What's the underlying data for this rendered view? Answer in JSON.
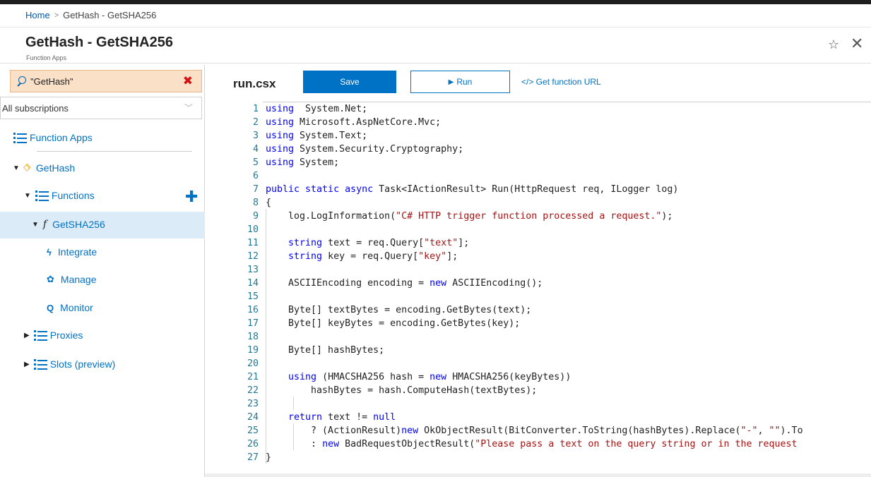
{
  "breadcrumb": {
    "home": "Home",
    "separator": ">",
    "current": "GetHash - GetSHA256"
  },
  "header": {
    "title": "GetHash - GetSHA256",
    "subtitle": "Function Apps",
    "pin_icon": "☆",
    "close_icon": "✕"
  },
  "sidebar": {
    "search_value": "\"GetHash\"",
    "clear_icon": "✖",
    "subscriptions": "All subscriptions",
    "chevron": "﹀",
    "function_apps": "Function Apps",
    "app_name": "GetHash",
    "functions_label": "Functions",
    "add_icon": "✚",
    "function_name": "GetSHA256",
    "function_glyph": "f",
    "integrate": "Integrate",
    "manage": "Manage",
    "monitor": "Monitor",
    "proxies": "Proxies",
    "slots": "Slots (preview)",
    "expand_tri": "▼",
    "collapse_tri": "▶",
    "integrate_icon": "ϟ",
    "manage_icon": "✿",
    "monitor_icon": "Q"
  },
  "toolbar": {
    "file": "run.csx",
    "save": "Save",
    "run": "Run",
    "run_icon": "▶",
    "get_url": "</> Get function URL"
  },
  "accent_color": "#0072c6",
  "editor": {
    "lines": [
      {
        "n": "1",
        "parts": [
          [
            "kw",
            "using"
          ],
          [
            "",
            "  System.Net;"
          ]
        ]
      },
      {
        "n": "2",
        "parts": [
          [
            "kw",
            "using"
          ],
          [
            "",
            " Microsoft.AspNetCore.Mvc;"
          ]
        ]
      },
      {
        "n": "3",
        "parts": [
          [
            "kw",
            "using"
          ],
          [
            "",
            " System.Text;"
          ]
        ]
      },
      {
        "n": "4",
        "parts": [
          [
            "kw",
            "using"
          ],
          [
            "",
            " System.Security.Cryptography;"
          ]
        ]
      },
      {
        "n": "5",
        "parts": [
          [
            "kw",
            "using"
          ],
          [
            "",
            " System;"
          ]
        ]
      },
      {
        "n": "6",
        "parts": []
      },
      {
        "n": "7",
        "parts": [
          [
            "kw",
            "public static async"
          ],
          [
            "",
            " Task<IActionResult> Run(HttpRequest req, ILogger log)"
          ]
        ]
      },
      {
        "n": "8",
        "parts": [
          [
            "",
            "{"
          ]
        ]
      },
      {
        "n": "9",
        "parts": [
          [
            "",
            "    log.LogInformation("
          ],
          [
            "str",
            "\"C# HTTP trigger function processed a request.\""
          ],
          [
            "",
            ");"
          ]
        ]
      },
      {
        "n": "10",
        "parts": []
      },
      {
        "n": "11",
        "parts": [
          [
            "kw",
            "    string"
          ],
          [
            "",
            " text = req.Query["
          ],
          [
            "str",
            "\"text\""
          ],
          [
            "",
            "];"
          ]
        ]
      },
      {
        "n": "12",
        "parts": [
          [
            "kw",
            "    string"
          ],
          [
            "",
            " key = req.Query["
          ],
          [
            "str",
            "\"key\""
          ],
          [
            "",
            "];"
          ]
        ]
      },
      {
        "n": "13",
        "parts": []
      },
      {
        "n": "14",
        "parts": [
          [
            "",
            "    ASCIIEncoding encoding = "
          ],
          [
            "kw",
            "new"
          ],
          [
            "",
            " ASCIIEncoding();"
          ]
        ]
      },
      {
        "n": "15",
        "parts": []
      },
      {
        "n": "16",
        "parts": [
          [
            "",
            "    Byte[] textBytes = encoding.GetBytes(text);"
          ]
        ]
      },
      {
        "n": "17",
        "parts": [
          [
            "",
            "    Byte[] keyBytes = encoding.GetBytes(key);"
          ]
        ]
      },
      {
        "n": "18",
        "parts": []
      },
      {
        "n": "19",
        "parts": [
          [
            "",
            "    Byte[] hashBytes;"
          ]
        ]
      },
      {
        "n": "20",
        "parts": []
      },
      {
        "n": "21",
        "parts": [
          [
            "kw",
            "    using"
          ],
          [
            "",
            " (HMACSHA256 hash = "
          ],
          [
            "kw",
            "new"
          ],
          [
            "",
            " HMACSHA256(keyBytes))"
          ]
        ]
      },
      {
        "n": "22",
        "parts": [
          [
            "",
            "        hashBytes = hash.ComputeHash(textBytes);"
          ]
        ]
      },
      {
        "n": "23",
        "parts": []
      },
      {
        "n": "24",
        "parts": [
          [
            "kw",
            "    return"
          ],
          [
            "",
            " text != "
          ],
          [
            "kw",
            "null"
          ]
        ]
      },
      {
        "n": "25",
        "parts": [
          [
            "",
            "        ? (ActionResult)"
          ],
          [
            "kw",
            "new"
          ],
          [
            "",
            " OkObjectResult(BitConverter.ToString(hashBytes).Replace("
          ],
          [
            "str",
            "\"-\""
          ],
          [
            "",
            ", "
          ],
          [
            "str",
            "\"\""
          ],
          [
            "",
            ").To"
          ]
        ]
      },
      {
        "n": "26",
        "parts": [
          [
            "",
            "        : "
          ],
          [
            "kw",
            "new"
          ],
          [
            "",
            " BadRequestObjectResult("
          ],
          [
            "str",
            "\"Please pass a text on the query string or in the request"
          ]
        ]
      },
      {
        "n": "27",
        "parts": [
          [
            "",
            "}"
          ]
        ]
      }
    ]
  }
}
